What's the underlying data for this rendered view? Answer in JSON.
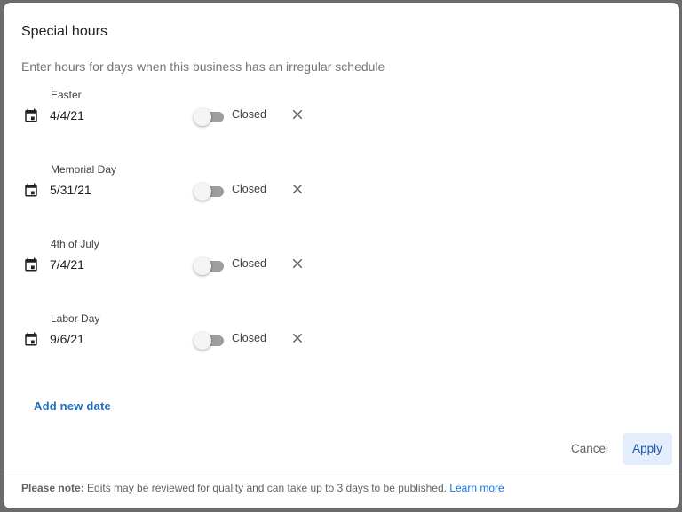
{
  "dialog": {
    "title": "Special hours",
    "subtitle": "Enter hours for days when this business has an irregular schedule"
  },
  "entries": [
    {
      "label": "Easter",
      "date": "4/4/21",
      "open": false,
      "status": "Closed",
      "icon": "calendar-icon",
      "remove_icon": "close-icon"
    },
    {
      "label": "Memorial Day",
      "date": "5/31/21",
      "open": false,
      "status": "Closed",
      "icon": "calendar-icon",
      "remove_icon": "close-icon"
    },
    {
      "label": "4th of July",
      "date": "7/4/21",
      "open": false,
      "status": "Closed",
      "icon": "calendar-icon",
      "remove_icon": "close-icon"
    },
    {
      "label": "Labor Day",
      "date": "9/6/21",
      "open": false,
      "status": "Closed",
      "icon": "calendar-icon",
      "remove_icon": "close-icon"
    }
  ],
  "actions": {
    "add_new_date": "Add new date",
    "cancel": "Cancel",
    "apply": "Apply"
  },
  "footer": {
    "note_label": "Please note:",
    "note_text": " Edits may be reviewed for quality and can take up to 3 days to be published. ",
    "learn_more": "Learn more"
  },
  "colors": {
    "accent": "#1a73e8",
    "apply_bg": "#e3edfb",
    "backdrop": "#6b6b6b"
  }
}
